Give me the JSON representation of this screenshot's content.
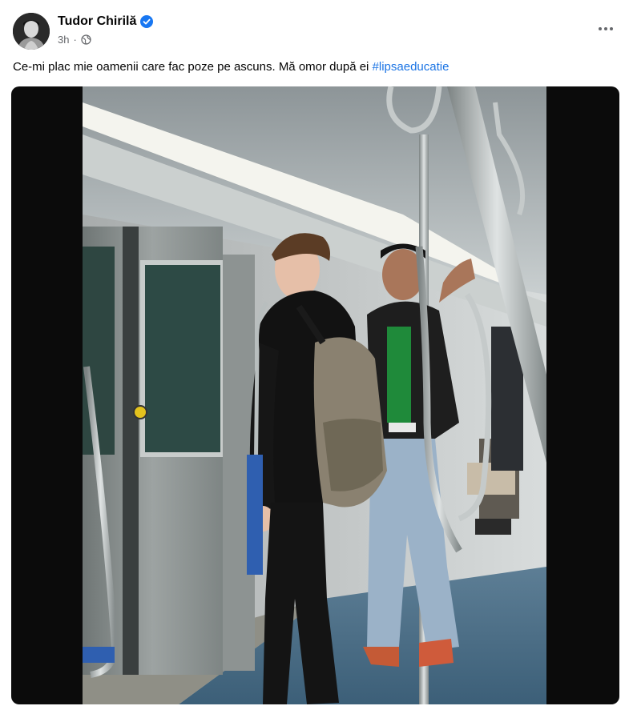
{
  "post": {
    "author_name": "Tudor Chirilă",
    "timestamp": "3h",
    "separator": "·",
    "text": "Ce-mi plac mie oamenii care fac poze pe ascuns. Mă omor după ei ",
    "hashtag": "#lipsaeducatie"
  },
  "icons": {
    "verified": "verified-badge-icon",
    "audience": "globe-icon",
    "more": "more-options-icon"
  },
  "colors": {
    "hashtag": "#1b74e4",
    "verified": "#1877f2",
    "meta": "#65676b"
  }
}
